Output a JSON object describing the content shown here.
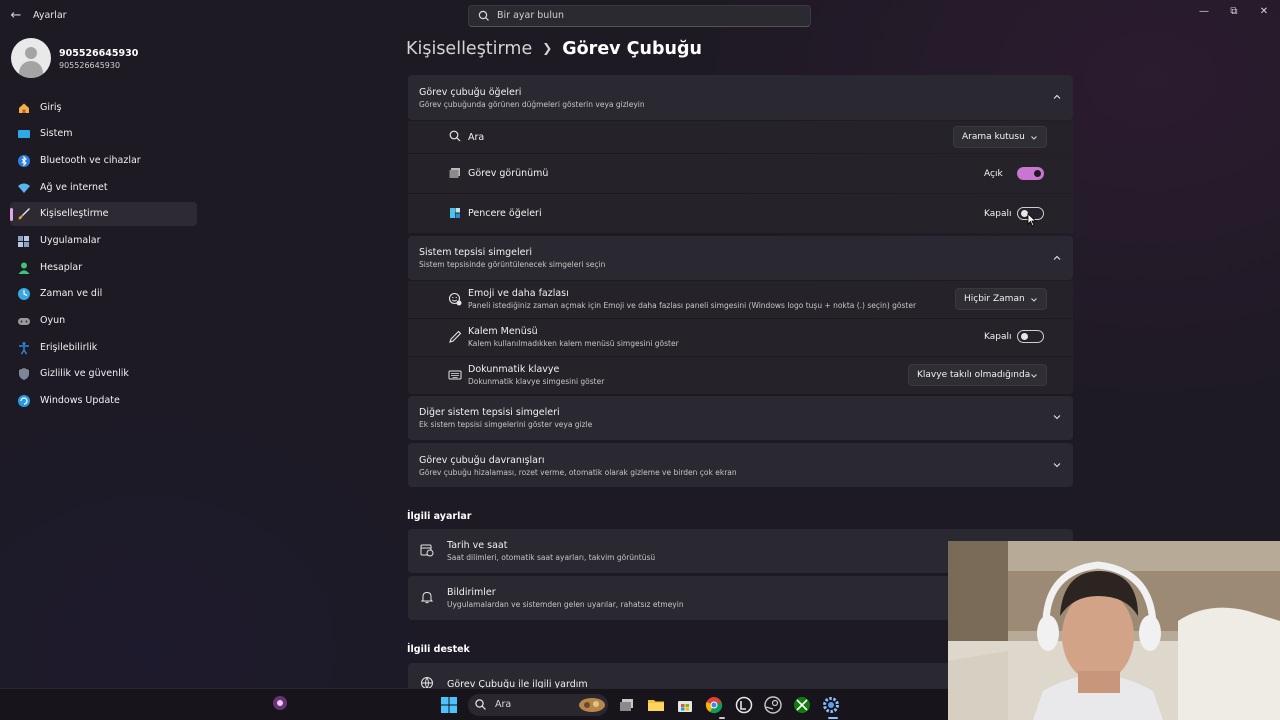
{
  "window": {
    "title": "Ayarlar",
    "search_placeholder": "Bir ayar bulun"
  },
  "profile": {
    "name": "905526645930",
    "subtitle": "905526645930"
  },
  "sidebar": {
    "items": [
      {
        "label": "Giriş",
        "icon": "home-icon",
        "color": "#f2b04a"
      },
      {
        "label": "Sistem",
        "icon": "monitor-icon",
        "color": "#2fa7e8"
      },
      {
        "label": "Bluetooth ve cihazlar",
        "icon": "bluetooth-icon",
        "color": "#2b7fe0"
      },
      {
        "label": "Ağ ve internet",
        "icon": "wifi-icon",
        "color": "#5ab4f0"
      },
      {
        "label": "Kişiselleştirme",
        "icon": "brush-icon",
        "color": "#e89a3c",
        "active": true
      },
      {
        "label": "Uygulamalar",
        "icon": "apps-icon",
        "color": "#8aa2c8"
      },
      {
        "label": "Hesaplar",
        "icon": "account-icon",
        "color": "#3cc47a"
      },
      {
        "label": "Zaman ve dil",
        "icon": "globe-clock-icon",
        "color": "#3aa7e0"
      },
      {
        "label": "Oyun",
        "icon": "gamepad-icon",
        "color": "#9a9a9a"
      },
      {
        "label": "Erişilebilirlik",
        "icon": "accessibility-icon",
        "color": "#2b86e0"
      },
      {
        "label": "Gizlilik ve güvenlik",
        "icon": "shield-icon",
        "color": "#7d8796"
      },
      {
        "label": "Windows Update",
        "icon": "update-icon",
        "color": "#2b9be0"
      }
    ]
  },
  "header": {
    "parent": "Kişiselleştirme",
    "current": "Görev Çubuğu"
  },
  "taskbar_items": {
    "title": "Görev çubuğu öğeleri",
    "desc": "Görev çubuğunda görünen düğmeleri gösterin veya gizleyin",
    "rows": {
      "search": {
        "label": "Ara",
        "value": "Arama kutusu"
      },
      "task_view": {
        "label": "Görev görünümü",
        "state": "Açık"
      },
      "widgets": {
        "label": "Pencere öğeleri",
        "state": "Kapalı"
      }
    }
  },
  "tray_icons": {
    "title": "Sistem tepsisi simgeleri",
    "desc": "Sistem tepsisinde görüntülenecek simgeleri seçin",
    "rows": {
      "emoji": {
        "label": "Emoji ve daha fazlası",
        "desc": "Paneli istediğiniz zaman açmak için Emoji ve daha fazlası paneli simgesini (Windows logo tuşu + nokta (.) seçin) göster",
        "value": "Hiçbir Zaman"
      },
      "pen": {
        "label": "Kalem Menüsü",
        "desc": "Kalem kullanılmadıkken kalem menüsü simgesini göster",
        "state": "Kapalı"
      },
      "keyboard": {
        "label": "Dokunmatik klavye",
        "desc": "Dokunmatik klavye simgesini göster",
        "value": "Klavye takılı olmadığında"
      }
    }
  },
  "other_tray": {
    "title": "Diğer sistem tepsisi simgeleri",
    "desc": "Ek sistem tepsisi simgelerini göster veya gizle"
  },
  "behaviors": {
    "title": "Görev çubuğu davranışları",
    "desc": "Görev çubuğu hizalaması, rozet verme, otomatik olarak gizleme ve birden çok ekran"
  },
  "related": {
    "heading": "İlgili ayarlar",
    "items": [
      {
        "label": "Tarih ve saat",
        "desc": "Saat dilimleri, otomatik saat ayarları, takvim görüntüsü"
      },
      {
        "label": "Bildirimler",
        "desc": "Uygulamalardan ve sistemden gelen uyarılar, rahatsız etmeyin"
      }
    ]
  },
  "support": {
    "heading": "İlgili destek",
    "items": [
      {
        "label": "Görev Çubuğu ile ilgili yardım"
      }
    ]
  },
  "taskbar": {
    "search_label": "Ara",
    "accent": "#c976d1"
  }
}
